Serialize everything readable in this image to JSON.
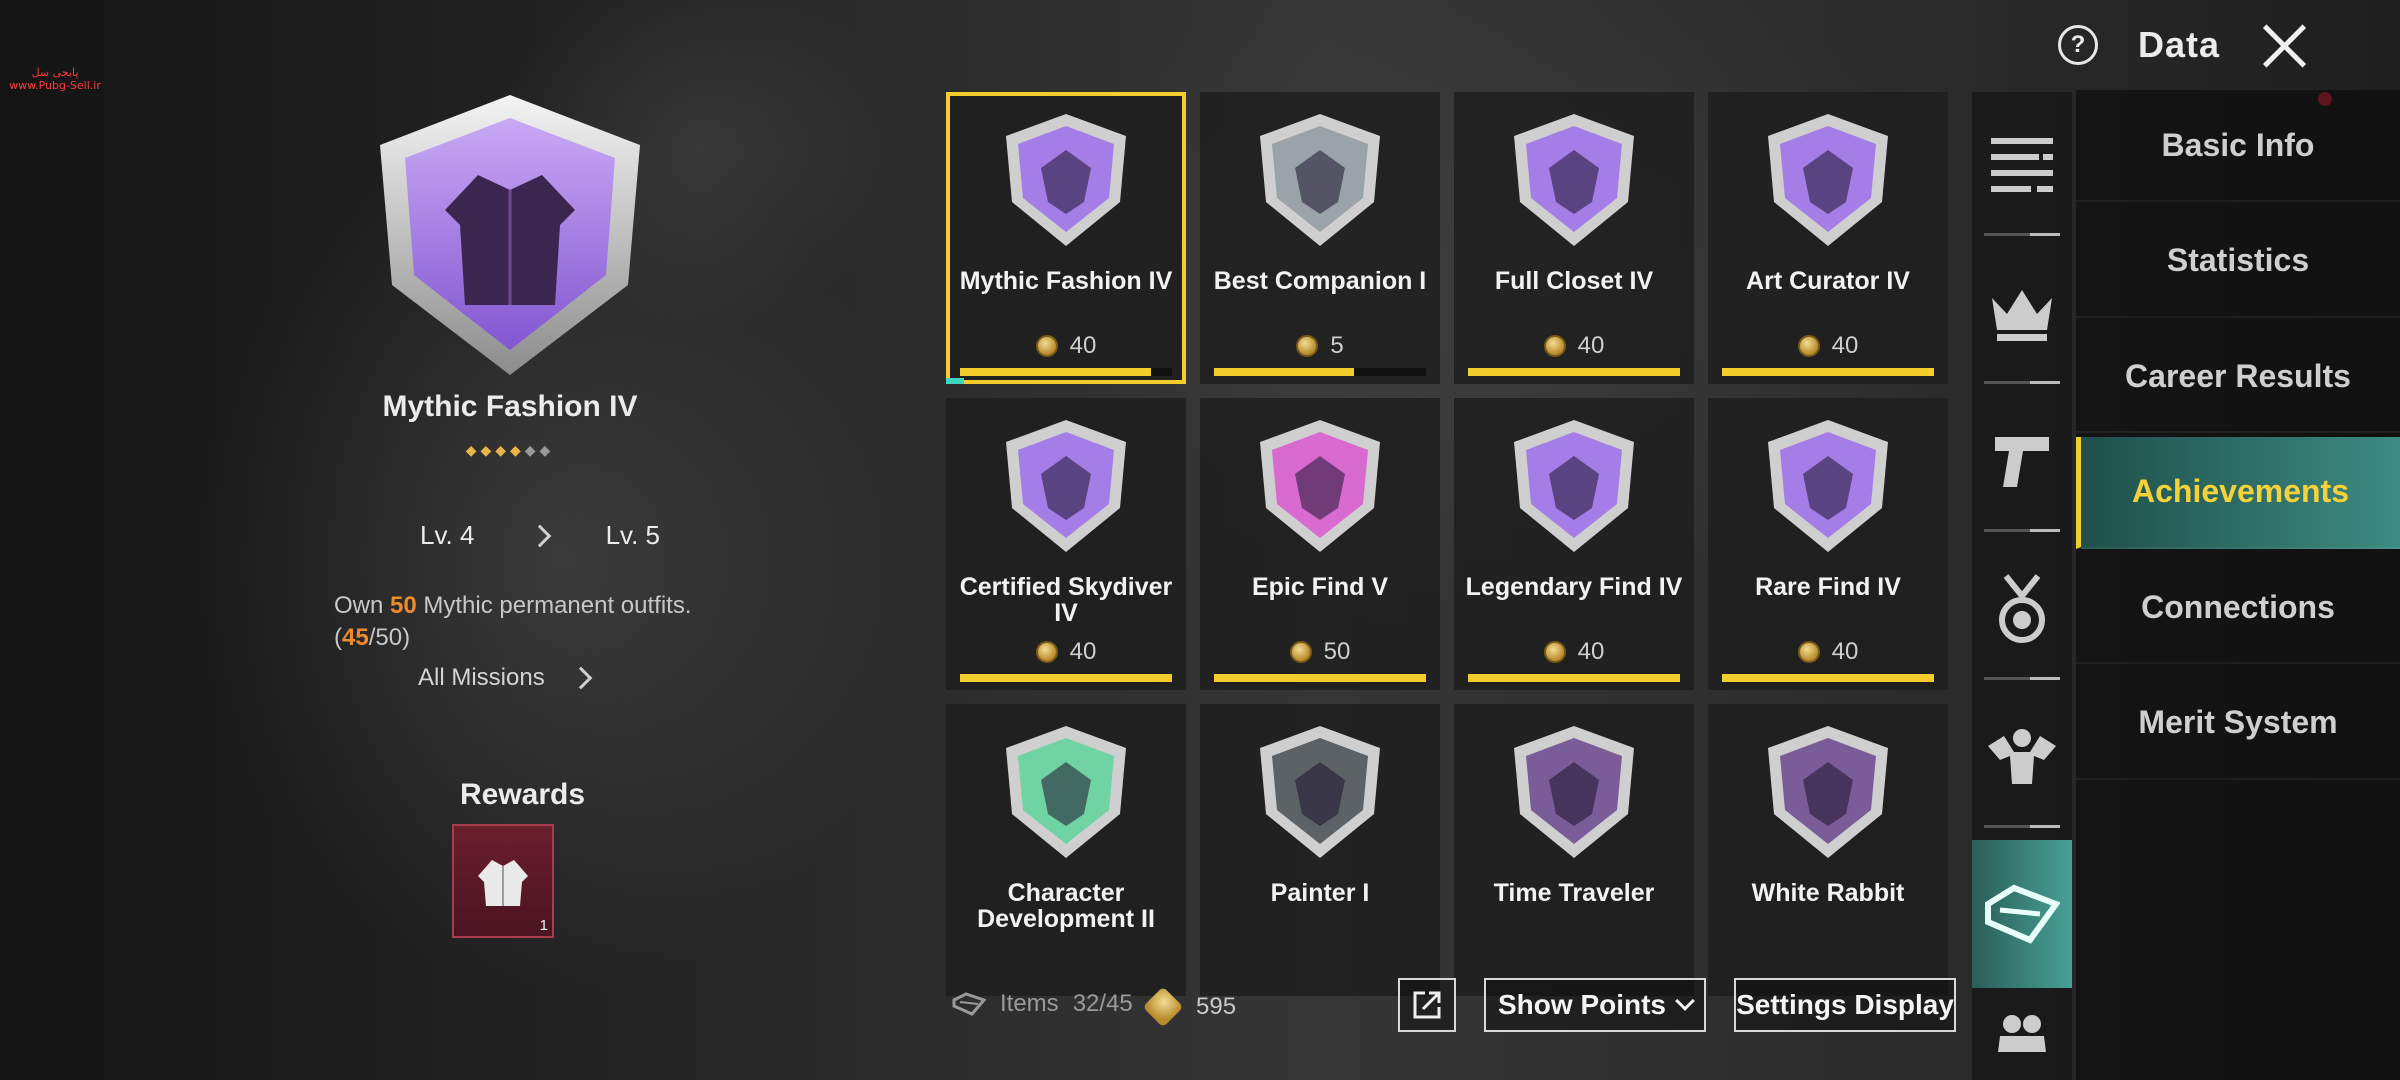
{
  "watermark": {
    "line1": "پابجی سل",
    "line2": "www.Pubg-Sell.ir"
  },
  "topbar": {
    "help_glyph": "?",
    "title": "Data"
  },
  "detail": {
    "name": "Mythic Fashion IV",
    "stars_filled": "◆◆◆◆",
    "stars_empty": "◆◆",
    "level_from": "Lv. 4",
    "level_to": "Lv. 5",
    "desc_prefix": "Own ",
    "desc_target": "50",
    "desc_suffix": " Mythic permanent outfits.",
    "progress_open": "(",
    "progress_current": "45",
    "progress_total": "/50)",
    "all_missions": "All Missions",
    "rewards_title": "Rewards",
    "reward_count": "1"
  },
  "cards": [
    {
      "name": "Mythic Fashion IV",
      "points": "40",
      "progress": 0.9,
      "color": "#a57de6",
      "selected": true
    },
    {
      "name": "Best Companion I",
      "points": "5",
      "progress": 0.66,
      "color": "#9aa3a8",
      "selected": false
    },
    {
      "name": "Full Closet IV",
      "points": "40",
      "progress": 1,
      "color": "#a57de6",
      "selected": false
    },
    {
      "name": "Art Curator IV",
      "points": "40",
      "progress": 1,
      "color": "#a57de6",
      "selected": false
    },
    {
      "name": "Certified Skydiver IV",
      "points": "40",
      "progress": 1,
      "color": "#a57de6",
      "selected": false
    },
    {
      "name": "Epic Find V",
      "points": "50",
      "progress": 1,
      "color": "#d86ad0",
      "selected": false
    },
    {
      "name": "Legendary Find IV",
      "points": "40",
      "progress": 1,
      "color": "#a57de6",
      "selected": false
    },
    {
      "name": "Rare Find IV",
      "points": "40",
      "progress": 1,
      "color": "#a57de6",
      "selected": false
    },
    {
      "name": "Character Development II",
      "points": "",
      "progress": null,
      "color": "#6fd3a4",
      "selected": false
    },
    {
      "name": "Painter I",
      "points": "",
      "progress": null,
      "color": "#5c6266",
      "selected": false
    },
    {
      "name": "Time Traveler",
      "points": "",
      "progress": null,
      "color": "#7a5c98",
      "selected": false
    },
    {
      "name": "White Rabbit",
      "points": "",
      "progress": null,
      "color": "#7a5c98",
      "selected": false
    }
  ],
  "bottom": {
    "items_label": "Items",
    "items_value": "32/45",
    "points_value": "595",
    "show_points": "Show Points",
    "settings_display": "Settings Display"
  },
  "icon_tabs": [
    "list-icon",
    "crown-icon",
    "pistol-icon",
    "medal-icon",
    "muscle-icon",
    "outfit-icon",
    "team-icon"
  ],
  "menu": [
    {
      "label": "Basic Info",
      "active": false
    },
    {
      "label": "Statistics",
      "active": false
    },
    {
      "label": "Career Results",
      "active": false
    },
    {
      "label": "Achievements",
      "active": true
    },
    {
      "label": "Connections",
      "active": false
    },
    {
      "label": "Merit System",
      "active": false
    }
  ]
}
